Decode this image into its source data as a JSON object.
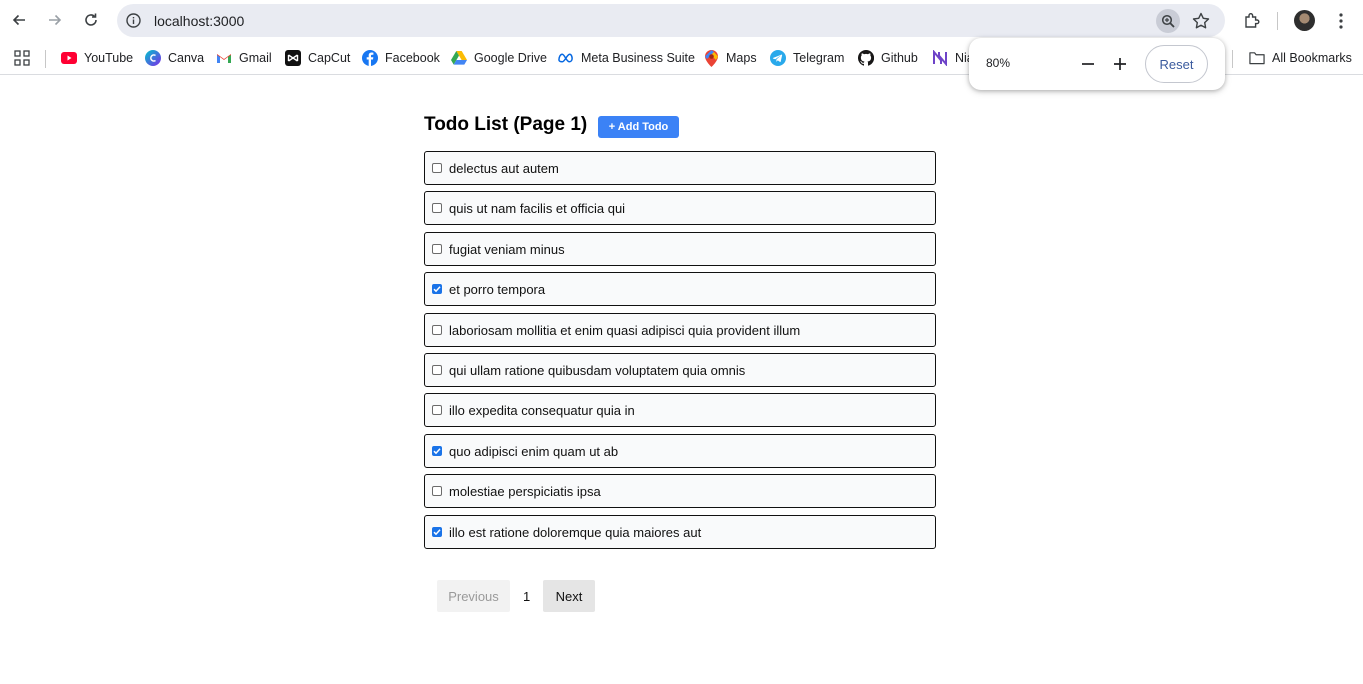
{
  "browser": {
    "url": "localhost:3000",
    "bookmarks": [
      {
        "label": "YouTube",
        "icon": "youtube-icon",
        "color": "#ff0033"
      },
      {
        "label": "Canva",
        "icon": "canva-icon",
        "color": "#7d2ae8"
      },
      {
        "label": "Gmail",
        "icon": "gmail-icon",
        "color": "#ea4335"
      },
      {
        "label": "CapCut",
        "icon": "capcut-icon",
        "color": "#000000"
      },
      {
        "label": "Facebook",
        "icon": "facebook-icon",
        "color": "#1877f2"
      },
      {
        "label": "Google Drive",
        "icon": "google-drive-icon",
        "color": "#34a853"
      },
      {
        "label": "Meta Business Suite",
        "icon": "meta-icon",
        "color": "#0668e1"
      },
      {
        "label": "Maps",
        "icon": "maps-icon",
        "color": "#ea4335"
      },
      {
        "label": "Telegram",
        "icon": "telegram-icon",
        "color": "#29a9eb"
      },
      {
        "label": "Github",
        "icon": "github-icon",
        "color": "#181717"
      },
      {
        "label": "Nia",
        "icon": "nia-icon",
        "color": "#6e43c8"
      }
    ],
    "all_bookmarks_label": "All Bookmarks",
    "zoom": {
      "level": "80%",
      "reset_label": "Reset"
    }
  },
  "page": {
    "title": "Todo List (Page 1)",
    "add_button_label": "+ Add Todo",
    "todos": [
      {
        "text": "delectus aut autem",
        "completed": false
      },
      {
        "text": "quis ut nam facilis et officia qui",
        "completed": false
      },
      {
        "text": "fugiat veniam minus",
        "completed": false
      },
      {
        "text": "et porro tempora",
        "completed": true
      },
      {
        "text": "laboriosam mollitia et enim quasi adipisci quia provident illum",
        "completed": false
      },
      {
        "text": "qui ullam ratione quibusdam voluptatem quia omnis",
        "completed": false
      },
      {
        "text": "illo expedita consequatur quia in",
        "completed": false
      },
      {
        "text": "quo adipisci enim quam ut ab",
        "completed": true
      },
      {
        "text": "molestiae perspiciatis ipsa",
        "completed": false
      },
      {
        "text": "illo est ratione doloremque quia maiores aut",
        "completed": true
      }
    ],
    "pagination": {
      "previous_label": "Previous",
      "current_page": "1",
      "next_label": "Next"
    }
  },
  "colors": {
    "accent": "#3b82f6",
    "checkbox_checked": "#1a73e8"
  }
}
